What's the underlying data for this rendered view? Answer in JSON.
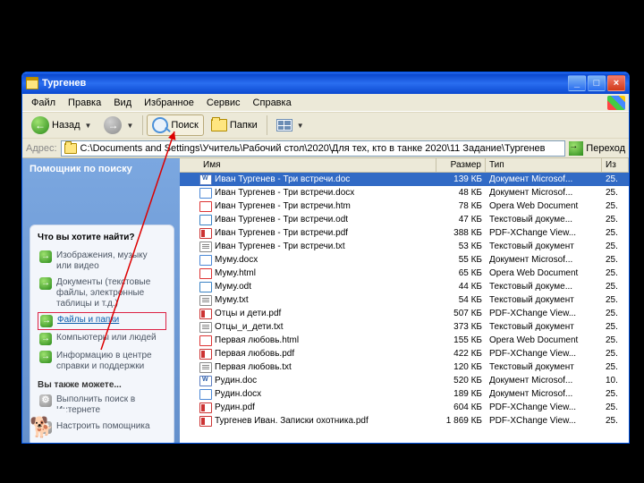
{
  "window": {
    "title": "Тургенев",
    "min": "_",
    "max": "□",
    "close": "×"
  },
  "menubar": [
    "Файл",
    "Правка",
    "Вид",
    "Избранное",
    "Сервис",
    "Справка"
  ],
  "toolbar": {
    "back": "Назад",
    "search": "Поиск",
    "folders": "Папки"
  },
  "address": {
    "label": "Адрес:",
    "path": "C:\\Documents and Settings\\Учитель\\Рабочий стол\\2020\\Для тех, кто в танке 2020\\11 Задание\\Тургенев",
    "go": "Переход"
  },
  "sidebar": {
    "helper": "Помощник по поиску",
    "question": "Что вы хотите найти?",
    "opts": [
      {
        "text": "Изображения, музыку или видео"
      },
      {
        "text": "Документы (текстовые файлы, электронные таблицы и т.д.)"
      },
      {
        "text": "Файлы и папки",
        "boxed": true,
        "link": true
      },
      {
        "text": "Компьютеры или людей"
      },
      {
        "text": "Информацию в центре справки и поддержки"
      }
    ],
    "also": "Вы также можете...",
    "extra": [
      {
        "text": "Выполнить поиск в Интернете"
      },
      {
        "text": "Настроить помощника"
      }
    ],
    "dog": "🐕"
  },
  "columns": {
    "name": "Имя",
    "size": "Размер",
    "type": "Тип",
    "mod": "Из"
  },
  "files": [
    {
      "name": "Иван Тургенев - Три встречи.doc",
      "size": "139 КБ",
      "type": "Документ Microsof...",
      "mod": "25.",
      "icon": "doc",
      "sel": true
    },
    {
      "name": "Иван Тургенев - Три встречи.docx",
      "size": "48 КБ",
      "type": "Документ Microsof...",
      "mod": "25.",
      "icon": "docx"
    },
    {
      "name": "Иван Тургенев - Три встречи.htm",
      "size": "78 КБ",
      "type": "Opera Web Document",
      "mod": "25.",
      "icon": "htm"
    },
    {
      "name": "Иван Тургенев - Три встречи.odt",
      "size": "47 КБ",
      "type": "Текстовый докуме...",
      "mod": "25.",
      "icon": "odt"
    },
    {
      "name": "Иван Тургенев - Три встречи.pdf",
      "size": "388 КБ",
      "type": "PDF-XChange View...",
      "mod": "25.",
      "icon": "pdf"
    },
    {
      "name": "Иван Тургенев - Три встречи.txt",
      "size": "53 КБ",
      "type": "Текстовый документ",
      "mod": "25.",
      "icon": "txt"
    },
    {
      "name": "Муму.docx",
      "size": "55 КБ",
      "type": "Документ Microsof...",
      "mod": "25.",
      "icon": "docx"
    },
    {
      "name": "Муму.html",
      "size": "65 КБ",
      "type": "Opera Web Document",
      "mod": "25.",
      "icon": "htm"
    },
    {
      "name": "Муму.odt",
      "size": "44 КБ",
      "type": "Текстовый докуме...",
      "mod": "25.",
      "icon": "odt"
    },
    {
      "name": "Муму.txt",
      "size": "54 КБ",
      "type": "Текстовый документ",
      "mod": "25.",
      "icon": "txt"
    },
    {
      "name": "Отцы и дети.pdf",
      "size": "507 КБ",
      "type": "PDF-XChange View...",
      "mod": "25.",
      "icon": "pdf"
    },
    {
      "name": "Отцы_и_дети.txt",
      "size": "373 КБ",
      "type": "Текстовый документ",
      "mod": "25.",
      "icon": "txt"
    },
    {
      "name": "Первая любовь.html",
      "size": "155 КБ",
      "type": "Opera Web Document",
      "mod": "25.",
      "icon": "htm"
    },
    {
      "name": "Первая любовь.pdf",
      "size": "422 КБ",
      "type": "PDF-XChange View...",
      "mod": "25.",
      "icon": "pdf"
    },
    {
      "name": "Первая любовь.txt",
      "size": "120 КБ",
      "type": "Текстовый документ",
      "mod": "25.",
      "icon": "txt"
    },
    {
      "name": "Рудин.doc",
      "size": "520 КБ",
      "type": "Документ Microsof...",
      "mod": "10.",
      "icon": "doc"
    },
    {
      "name": "Рудин.docx",
      "size": "189 КБ",
      "type": "Документ Microsof...",
      "mod": "25.",
      "icon": "docx"
    },
    {
      "name": "Рудин.pdf",
      "size": "604 КБ",
      "type": "PDF-XChange View...",
      "mod": "25.",
      "icon": "pdf"
    },
    {
      "name": "Тургенев Иван. Записки охотника.pdf",
      "size": "1 869 КБ",
      "type": "PDF-XChange View...",
      "mod": "25.",
      "icon": "pdf"
    }
  ]
}
